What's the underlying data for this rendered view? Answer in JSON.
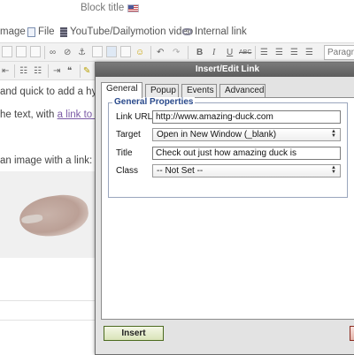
{
  "editor": {
    "block_title_label": "Block title",
    "insert_bar": {
      "image": "mage",
      "file": "File",
      "video": "YouTube/Dailymotion video",
      "internal_link": "Internal link"
    },
    "toolbar": {
      "bold": "B",
      "italic": "I",
      "underline": "U",
      "strike": "ABC",
      "paragraph": "Paragra"
    },
    "content": {
      "line1": "and quick to add a hype",
      "line2_prefix": "he text, with ",
      "line2_link": "a link to a r",
      "line3": "an image with a link:"
    }
  },
  "dialog": {
    "title": "Insert/Edit Link",
    "tabs": [
      {
        "label": "General",
        "active": true
      },
      {
        "label": "Popup",
        "active": false
      },
      {
        "label": "Events",
        "active": false
      },
      {
        "label": "Advanced",
        "active": false
      }
    ],
    "fieldset_legend": "General Properties",
    "fields": {
      "link_url": {
        "label": "Link URL",
        "value": "http://www.amazing-duck.com"
      },
      "target": {
        "label": "Target",
        "value": "Open in New Window (_blank)"
      },
      "title": {
        "label": "Title",
        "value": "Check out just how amazing duck is"
      },
      "class": {
        "label": "Class",
        "value": "-- Not Set --"
      }
    },
    "insert_button": "Insert"
  },
  "colors": {
    "dialog_title_bar": "#6a6a6a",
    "legend_blue": "#2a4a8c",
    "link_purple": "#7b5aa6",
    "insert_border_green": "#4b6a1f",
    "cancel_border_red": "#8a2b20"
  }
}
